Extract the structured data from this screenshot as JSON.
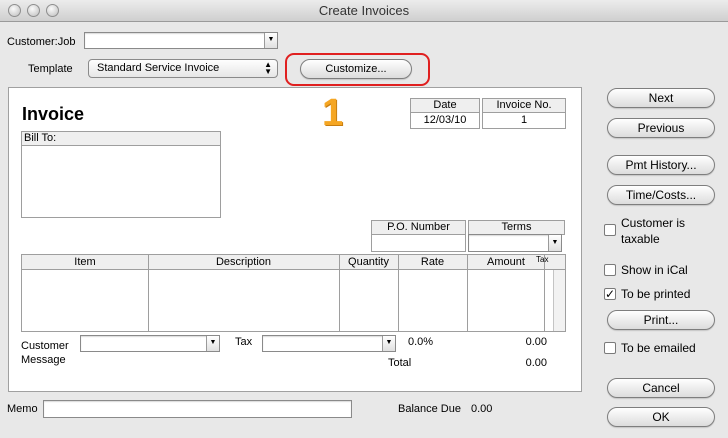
{
  "window": {
    "title": "Create Invoices"
  },
  "header": {
    "customer_job_label": "Customer:Job",
    "customer_job_value": "",
    "template_label": "Template",
    "template_value": "Standard Service Invoice",
    "customize_label": "Customize..."
  },
  "annotation": {
    "marker": "1",
    "highlight_color": "#e02020",
    "marker_color": "#f5a623"
  },
  "invoice": {
    "title": "Invoice",
    "date_label": "Date",
    "date_value": "12/03/10",
    "invoice_no_label": "Invoice No.",
    "invoice_no_value": "1",
    "bill_to_label": "Bill To:",
    "po_number_label": "P.O. Number",
    "terms_label": "Terms",
    "columns": [
      "Item",
      "Description",
      "Quantity",
      "Rate",
      "Amount"
    ],
    "tax_col_label": "Tax",
    "customer_message_label_1": "Customer",
    "customer_message_label_2": "Message",
    "tax_label": "Tax",
    "tax_rate": "0.0%",
    "tax_amount": "0.00",
    "total_label": "Total",
    "total_value": "0.00"
  },
  "footer": {
    "memo_label": "Memo",
    "balance_due_label": "Balance Due",
    "balance_due_value": "0.00"
  },
  "side_buttons": {
    "next": "Next",
    "previous": "Previous",
    "pmt_history": "Pmt History...",
    "time_costs": "Time/Costs...",
    "print": "Print...",
    "cancel": "Cancel",
    "ok": "OK"
  },
  "checkboxes": {
    "customer_taxable_1": "Customer is",
    "customer_taxable_2": "taxable",
    "customer_taxable_checked": false,
    "show_in_ical": "Show in iCal",
    "show_in_ical_checked": false,
    "to_be_printed": "To be printed",
    "to_be_printed_checked": true,
    "check_glyph": "✓",
    "to_be_emailed": "To be emailed",
    "to_be_emailed_checked": false
  }
}
